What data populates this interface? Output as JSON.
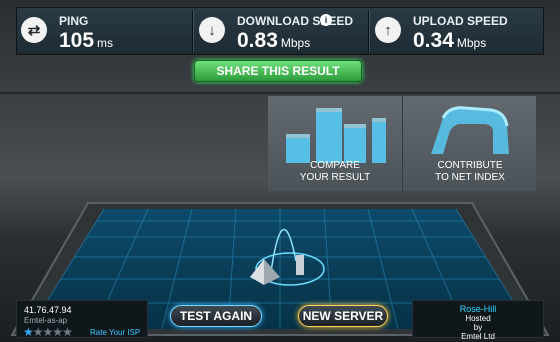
{
  "stats": {
    "ping": {
      "label": "PING",
      "value": "105",
      "unit": "ms",
      "icon": "ping-arrows-icon"
    },
    "download": {
      "label": "DOWNLOAD SPEED",
      "value": "0.83",
      "unit": "Mbps",
      "icon": "download-arrow-icon",
      "info": "i"
    },
    "upload": {
      "label": "UPLOAD SPEED",
      "value": "0.34",
      "unit": "Mbps",
      "icon": "upload-arrow-icon"
    }
  },
  "share": {
    "label": "SHARE THIS RESULT"
  },
  "cards": {
    "compare": {
      "label_1": "COMPARE",
      "label_2": "YOUR RESULT",
      "icon": "bar-chart-icon"
    },
    "contribute": {
      "label_1": "CONTRIBUTE",
      "label_2": "TO NET INDEX",
      "icon": "ribbon-graph-icon"
    }
  },
  "isp": {
    "ip": "41.76.47.94",
    "name": "Emtel-as-ap",
    "rating": "1 of 5",
    "rate_label": "Rate Your ISP"
  },
  "buttons": {
    "test_again": "TEST AGAIN",
    "new_server": "NEW SERVER"
  },
  "server": {
    "city": "Rose-Hill",
    "hosted_by_1": "Hosted",
    "hosted_by_2": "by",
    "host_name": "Emtel Ltd"
  },
  "colors": {
    "accent_blue": "#36d4ff",
    "share_green": "#2c9b3a",
    "new_server_glow": "#ffc629"
  }
}
